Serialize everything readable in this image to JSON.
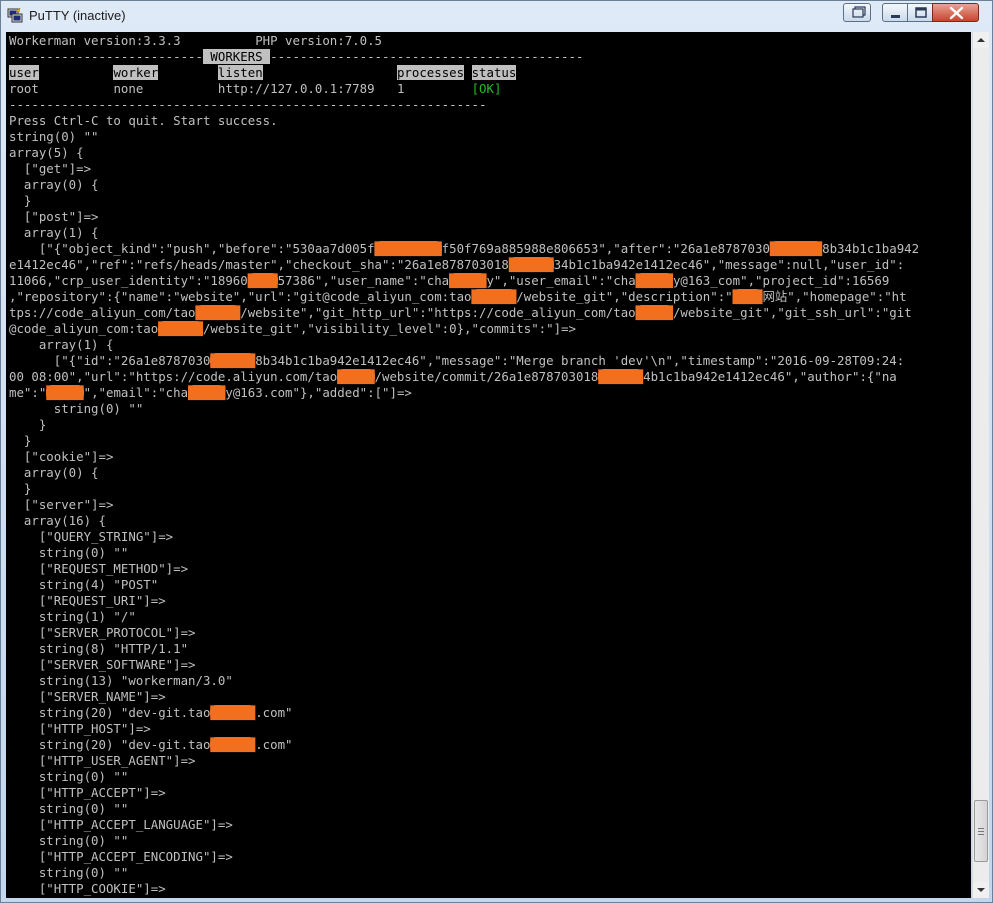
{
  "window": {
    "title": "PuTTY (inactive)",
    "icon": "putty-icon"
  },
  "controls": {
    "restore_icon": "restore-icon",
    "minimize_icon": "minimize-icon",
    "maximize_icon": "maximize-icon",
    "close_icon": "close-icon"
  },
  "colors": {
    "terminal_bg": "#000000",
    "terminal_fg": "#c0c0c0",
    "highlight_bg": "#c0c0c0",
    "ok_green": "#20c020"
  },
  "terminal": {
    "header": {
      "workerman_version": "Workerman version:3.3.3",
      "php_version": "PHP version:7.0.5",
      "dash_left": "--------------------------",
      "workers_label": " WORKERS ",
      "dash_right": "------------------------------------------",
      "col_user": "user",
      "col_worker": "worker",
      "col_listen": "listen",
      "col_processes": "processes",
      "col_status": "status",
      "row_user": "root",
      "row_worker": "none",
      "row_listen": "http://127.0.0.1:7789",
      "row_processes": "1",
      "row_status": "[OK]",
      "separator": "----------------------------------------------------------------"
    },
    "lines": [
      "Press Ctrl-C to quit. Start success.",
      "string(0) \"\"",
      "array(5) {",
      "  [\"get\"]=>",
      "  array(0) {",
      "  }",
      "  [\"post\"]=>",
      "  array(1) {",
      "    [\"{\"object_kind\":\"push\",\"before\":\"530aa7d005f█████████f50f769a885988e806653\",\"after\":\"26a1e8787030███████8b34b1c1ba942",
      "e1412ec46\",\"ref\":\"refs/heads/master\",\"checkout_sha\":\"26a1e878703018██████34b1c1ba942e1412ec46\",\"message\":null,\"user_id\":",
      "11066,\"crp_user_identity\":\"18960████57386\",\"user_name\":\"cha█████y\",\"user_email\":\"cha█████y@163_com\",\"project_id\":16569",
      ",\"repository\":{\"name\":\"website\",\"url\":\"git@code_aliyun_com:tao██████/website_git\",\"description\":\"████网站\",\"homepage\":\"ht",
      "tps://code_aliyun_com/tao██████/website\",\"git_http_url\":\"https://code_aliyun_com/tao█████/website_git\",\"git_ssh_url\":\"git",
      "@code_aliyun_com:tao██████/website_git\",\"visibility_level\":0},\"commits\":\"]=>",
      "    array(1) {",
      "      [\"{\"id\":\"26a1e8787030██████8b34b1c1ba942e1412ec46\",\"message\":\"Merge branch 'dev'\\n\",\"timestamp\":\"2016-09-28T09:24:",
      "00 08:00\",\"url\":\"https://code.aliyun.com/tao█████/website/commit/26a1e878703018██████4b1c1ba942e1412ec46\",\"author\":{\"na",
      "me\":\"█████\",\"email\":\"cha█████y@163.com\"},\"added\":[\"]=>",
      "      string(0) \"\"",
      "    }",
      "  }",
      "  [\"cookie\"]=>",
      "  array(0) {",
      "  }",
      "  [\"server\"]=>",
      "  array(16) {",
      "    [\"QUERY_STRING\"]=>",
      "    string(0) \"\"",
      "    [\"REQUEST_METHOD\"]=>",
      "    string(4) \"POST\"",
      "    [\"REQUEST_URI\"]=>",
      "    string(1) \"/\"",
      "    [\"SERVER_PROTOCOL\"]=>",
      "    string(8) \"HTTP/1.1\"",
      "    [\"SERVER_SOFTWARE\"]=>",
      "    string(13) \"workerman/3.0\"",
      "    [\"SERVER_NAME\"]=>",
      "    string(20) \"dev-git.tao██████.com\"",
      "    [\"HTTP_HOST\"]=>",
      "    string(20) \"dev-git.tao██████.com\"",
      "    [\"HTTP_USER_AGENT\"]=>",
      "    string(0) \"\"",
      "    [\"HTTP_ACCEPT\"]=>",
      "    string(0) \"\"",
      "    [\"HTTP_ACCEPT_LANGUAGE\"]=>",
      "    string(0) \"\"",
      "    [\"HTTP_ACCEPT_ENCODING\"]=>",
      "    string(0) \"\"",
      "    [\"HTTP_COOKIE\"]=>"
    ]
  }
}
